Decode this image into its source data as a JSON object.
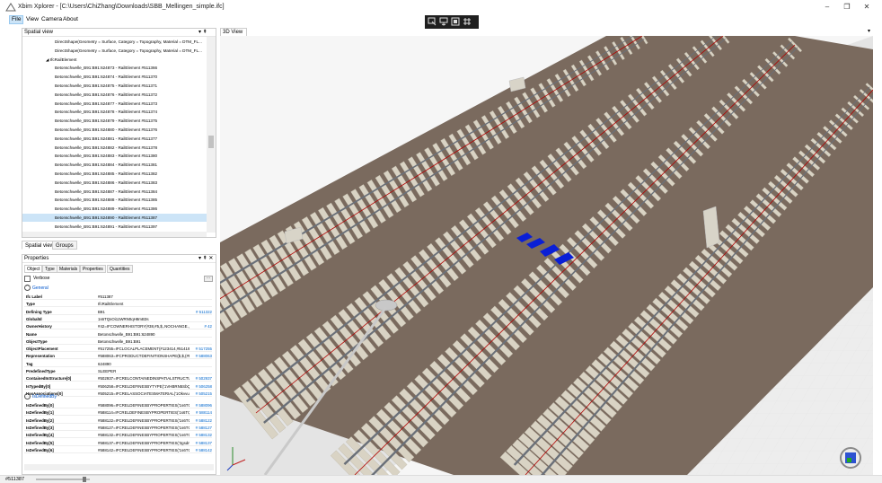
{
  "window": {
    "title": "Xbim Xplorer - [C:\\Users\\ChiZhang\\Downloads\\SBB_Mellingen_simple.ifc]",
    "controls": [
      "–",
      "❐",
      "✕"
    ]
  },
  "menu": [
    "File",
    "View",
    "Camera",
    "About"
  ],
  "toolbar": {
    "icons": [
      "select-icon",
      "zoom-selected-icon",
      "fit-view-icon",
      "toggle-icon"
    ]
  },
  "spatial_view": {
    "title": "Spatial view",
    "pin": "▾ ⇞",
    "rows": [
      "DirectShape(Geometry = Surface, Category = Topography, Material = DTM_FL...",
      "DirectShape(Geometry = Surface, Category = Topography, Material = DTM_FL...",
      "◢ IfcRailElement",
      "Betonschwelle_B91:B91:624873 - RailElement #511366",
      "Betonschwelle_B91:B91:624874 - RailElement #511370",
      "Betonschwelle_B91:B91:624875 - RailElement #511371",
      "Betonschwelle_B91:B91:624876 - RailElement #511372",
      "Betonschwelle_B91:B91:624877 - RailElement #511373",
      "Betonschwelle_B91:B91:624878 - RailElement #511374",
      "Betonschwelle_B91:B91:624879 - RailElement #511375",
      "Betonschwelle_B91:B91:624880 - RailElement #511376",
      "Betonschwelle_B91:B91:624881 - RailElement #511377",
      "Betonschwelle_B91:B91:624882 - RailElement #511378",
      "Betonschwelle_B91:B91:624883 - RailElement #511380",
      "Betonschwelle_B91:B91:624884 - RailElement #511381",
      "Betonschwelle_B91:B91:624885 - RailElement #511382",
      "Betonschwelle_B91:B91:624886 - RailElement #511383",
      "Betonschwelle_B91:B91:624887 - RailElement #511384",
      "Betonschwelle_B91:B91:624888 - RailElement #511385",
      "Betonschwelle_B91:B91:624889 - RailElement #511386",
      "Betonschwelle_B91:B91:624890 - RailElement #511387",
      "Betonschwelle_B91:B91:624891 - RailElement #511397"
    ],
    "selected_index": 20,
    "tabs": [
      "Spatial view",
      "Groups"
    ]
  },
  "properties": {
    "title": "Properties",
    "pin": "▾ ⇞ ✕",
    "tabs": [
      "Object",
      "Type",
      "Materials",
      "Properties",
      "Quantities"
    ],
    "verbose_label": "Verbose",
    "general_label": "General",
    "rows": [
      {
        "k": "Ifc Label",
        "v": "#511387",
        "l": ""
      },
      {
        "k": "Type",
        "v": "IfcRailElement",
        "l": ""
      },
      {
        "k": "Defining Type",
        "v": "B91",
        "l": "# 511322"
      },
      {
        "k": "GlobalId",
        "v": "1s6TQsOi11WRN0qH8mB3s",
        "l": ""
      },
      {
        "k": "OwnerHistory",
        "v": "#42=IFCOWNERHISTORY(#38,#5,$,.NOCHANGE.,$,$,$,1551 ...",
        "l": "# 42"
      },
      {
        "k": "Name",
        "v": "Betonschwelle_B91:B91:624890",
        "l": ""
      },
      {
        "k": "ObjectType",
        "v": "Betonschwelle_B91:B91",
        "l": ""
      },
      {
        "k": "ObjectPlacement",
        "v": "#517255=IFCLOCALPLACEMENT(#123414,#514197);",
        "l": "# 517255"
      },
      {
        "k": "Representation",
        "v": "#588063=IFCPRODUCTDEFINITIONSHAPE($,$,(#58809",
        "l": "# 588063"
      },
      {
        "k": "Tag",
        "v": "624890",
        "l": ""
      },
      {
        "k": "PredefinedType",
        "v": "SLEEPER",
        "l": ""
      },
      {
        "k": "ContainedInStructure[0]",
        "v": "#502937=IFCRELCONTAINEDINSPATIALSTRUCTURE('3",
        "l": "# 502937"
      },
      {
        "k": "IsTypedBy[0]",
        "v": "#506258=IFCRELDEFINESBYTYPE('1VHBRN5SbQHCH",
        "l": "# 506258"
      },
      {
        "k": "HasAssociations[0]",
        "v": "#505215=IFCRELASSOCIATESMATERIAL('1OkvvuFP0L",
        "l": "# 505215"
      }
    ],
    "defined_label": "IsDefinedBy",
    "defined_rows": [
      {
        "k": "IsDefinedBy[0]",
        "v": "#588096=IFCRELDEFINESBYPROPERTIES('1s6TQsOi11",
        "l": "# 588096"
      },
      {
        "k": "IsDefinedBy[1]",
        "v": "#588114=IFCRELDEFINESBYPROPERTIES('1s6TQsOi11",
        "l": "# 588114"
      },
      {
        "k": "IsDefinedBy[2]",
        "v": "#588122=IFCRELDEFINESBYPROPERTIES('1s6TQsOi11",
        "l": "# 588122"
      },
      {
        "k": "IsDefinedBy[3]",
        "v": "#588127=IFCRELDEFINESBYPROPERTIES('1s6TQsOi11",
        "l": "# 588127"
      },
      {
        "k": "IsDefinedBy[4]",
        "v": "#588132=IFCRELDEFINESBYPROPERTIES('1s6TQsOi11",
        "l": "# 588132"
      },
      {
        "k": "IsDefinedBy[5]",
        "v": "#588137=IFCRELDEFINESBYPROPERTIES('3gsdm268vB",
        "l": "# 588137"
      },
      {
        "k": "IsDefinedBy[6]",
        "v": "#588142=IFCRELDEFINESBYPROPERTIES('1s6TQsOi11",
        "l": "# 588142"
      }
    ]
  },
  "view3d": {
    "tab": "3D View",
    "menu_glyph": "▾"
  },
  "status": {
    "text": "#511387"
  },
  "colors": {
    "ballast": "#7a6a5e",
    "sleeper": "#d9d3c4",
    "rail": "#6a7079",
    "center_line": "#b00000",
    "highlight": "#0a1fd6",
    "slab": "#e2e2e2"
  }
}
